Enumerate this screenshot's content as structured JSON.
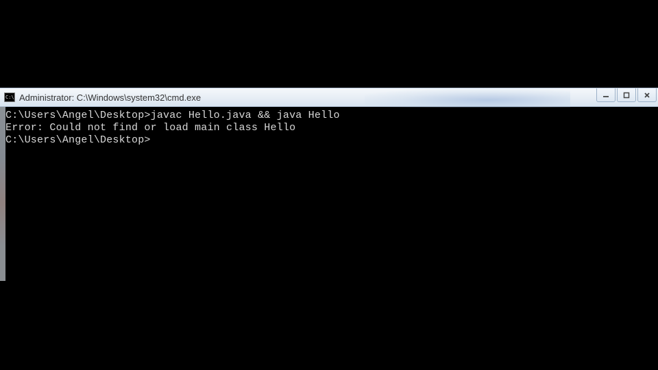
{
  "window": {
    "icon_text": "C:\\",
    "title": "Administrator: C:\\Windows\\system32\\cmd.exe",
    "controls": {
      "minimize": "minimize",
      "maximize": "maximize",
      "close": "close"
    }
  },
  "console": {
    "lines": [
      {
        "prompt": "C:\\Users\\Angel\\Desktop>",
        "command": "javac Hello.java && java Hello"
      },
      {
        "text": "Error: Could not find or load main class Hello"
      },
      {
        "text": ""
      },
      {
        "prompt": "C:\\Users\\Angel\\Desktop>",
        "command": ""
      }
    ]
  }
}
